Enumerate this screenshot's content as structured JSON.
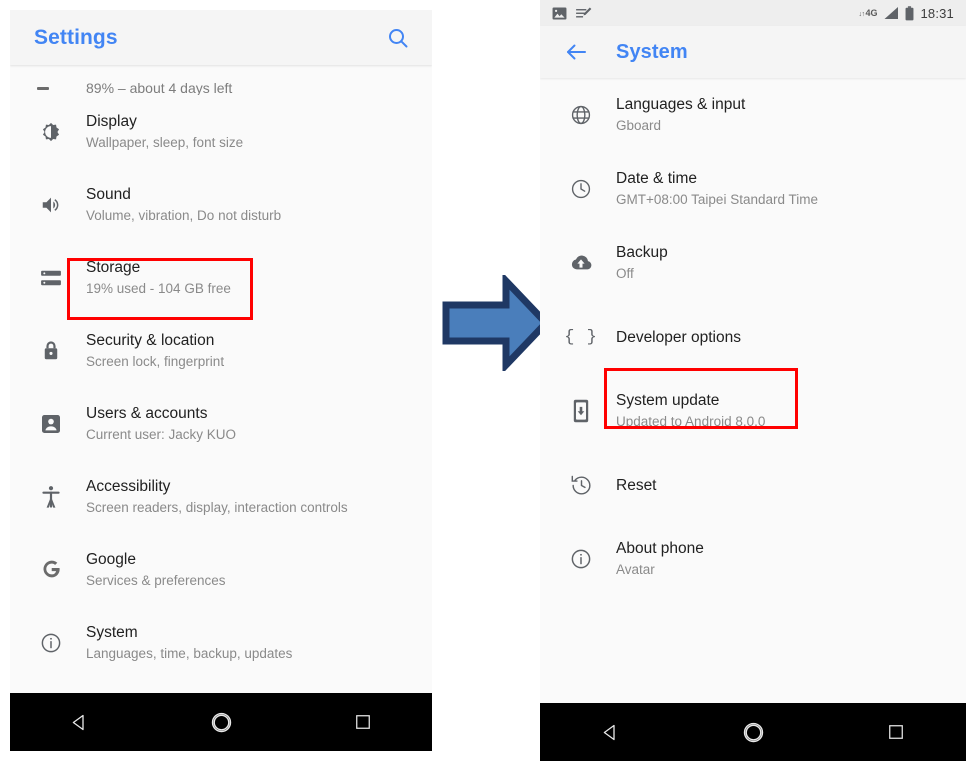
{
  "left_phone": {
    "appbar": {
      "title": "Settings",
      "search_icon": "search-icon"
    },
    "partial_row": {
      "text": "89% – about 4 days left"
    },
    "items": [
      {
        "icon": "brightness-icon",
        "title": "Display",
        "subtitle": "Wallpaper, sleep, font size"
      },
      {
        "icon": "volume-icon",
        "title": "Sound",
        "subtitle": "Volume, vibration, Do not disturb"
      },
      {
        "icon": "storage-icon",
        "title": "Storage",
        "subtitle": "19% used - 104 GB free",
        "highlighted": true
      },
      {
        "icon": "lock-icon",
        "title": "Security & location",
        "subtitle": "Screen lock, fingerprint"
      },
      {
        "icon": "person-icon",
        "title": "Users & accounts",
        "subtitle": "Current user: Jacky KUO"
      },
      {
        "icon": "accessibility-icon",
        "title": "Accessibility",
        "subtitle": "Screen readers, display, interaction controls"
      },
      {
        "icon": "google-icon",
        "title": "Google",
        "subtitle": "Services & preferences"
      },
      {
        "icon": "info-icon",
        "title": "System",
        "subtitle": "Languages, time, backup, updates"
      }
    ],
    "navbar": {
      "back": "back-triangle-icon",
      "home": "home-circle-icon",
      "recents": "recents-square-icon"
    }
  },
  "right_phone": {
    "statusbar": {
      "left_icons": [
        "image-icon",
        "edit-note-icon"
      ],
      "network_label": "4G",
      "network_arrows": "↓↑",
      "signal_icon": "signal-bars-icon",
      "battery_icon": "battery-full-icon",
      "time": "18:31"
    },
    "appbar": {
      "back_icon": "arrow-back-icon",
      "title": "System"
    },
    "items": [
      {
        "icon": "globe-icon",
        "title": "Languages & input",
        "subtitle": "Gboard"
      },
      {
        "icon": "clock-icon",
        "title": "Date & time",
        "subtitle": "GMT+08:00 Taipei Standard Time"
      },
      {
        "icon": "cloud-upload-icon",
        "title": "Backup",
        "subtitle": "Off"
      },
      {
        "icon": "braces-icon",
        "title": "Developer options",
        "subtitle": ""
      },
      {
        "icon": "system-update-icon",
        "title": "System update",
        "subtitle": "Updated to Android 8.0.0",
        "highlighted": true
      },
      {
        "icon": "history-icon",
        "title": "Reset",
        "subtitle": ""
      },
      {
        "icon": "info-icon",
        "title": "About phone",
        "subtitle": "Avatar"
      }
    ],
    "navbar": {
      "back": "back-triangle-icon",
      "home": "home-circle-icon",
      "recents": "recents-square-icon"
    }
  },
  "annotation": {
    "arrow": {
      "name": "flow-arrow-right",
      "fill": "#4a7ebb",
      "stroke": "#1f3864"
    },
    "highlight_color": "#ff0000"
  }
}
